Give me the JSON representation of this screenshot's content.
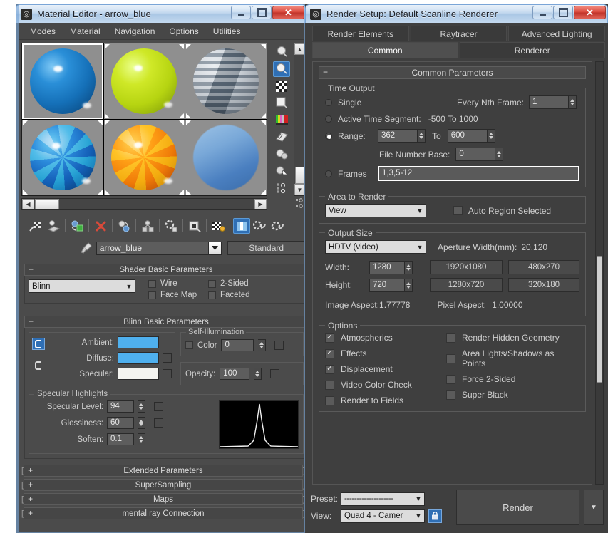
{
  "material_editor": {
    "title": "Material Editor - arrow_blue",
    "icon": "max-logo-icon",
    "window_buttons": {
      "minimize": "minimize-icon",
      "maximize": "maximize-icon",
      "close": "close-icon"
    },
    "menus": [
      "Modes",
      "Material",
      "Navigation",
      "Options",
      "Utilities"
    ],
    "slots": [
      {
        "name": "slot-1",
        "color": "#1878c8",
        "active": true
      },
      {
        "name": "slot-2",
        "color": "#c8e020",
        "active": false
      },
      {
        "name": "slot-3",
        "color": "#b4b4b4",
        "active": false
      },
      {
        "name": "slot-4",
        "color": "#3a9cd8",
        "active": false
      },
      {
        "name": "slot-5",
        "color": "#f0a018",
        "active": false
      },
      {
        "name": "slot-6",
        "color": "#6c9ed0",
        "active": false
      }
    ],
    "material_name": "arrow_blue",
    "material_type_button": "Standard",
    "shader_basic": {
      "header": "Shader Basic Parameters",
      "shader": "Blinn",
      "checks": [
        {
          "label": "Wire",
          "checked": false
        },
        {
          "label": "2-Sided",
          "checked": false
        },
        {
          "label": "Face Map",
          "checked": false
        },
        {
          "label": "Faceted",
          "checked": false
        }
      ]
    },
    "blinn_basic": {
      "header": "Blinn Basic Parameters",
      "ambient_label": "Ambient:",
      "ambient_color": "#4fb0ee",
      "diffuse_label": "Diffuse:",
      "diffuse_color": "#4fb0ee",
      "specular_label": "Specular:",
      "specular_color": "#f4f4f0",
      "self_illum_label": "Self-Illumination",
      "self_illum_color_label": "Color",
      "self_illum_value": "0",
      "self_illum_checked": false,
      "opacity_label": "Opacity:",
      "opacity_value": "100",
      "specular_highlights_label": "Specular Highlights",
      "specular_level_label": "Specular Level:",
      "specular_level_value": "94",
      "glossiness_label": "Glossiness:",
      "glossiness_value": "60",
      "soften_label": "Soften:",
      "soften_value": "0.1"
    },
    "collapsed_rollouts": [
      "Extended Parameters",
      "SuperSampling",
      "Maps",
      "mental ray Connection"
    ],
    "toolbar_icons": [
      "get-material-icon",
      "put-material-to-scene-icon",
      "assign-material-to-selection-icon",
      "reset-map-icon",
      "make-material-copy-icon",
      "make-unique-icon",
      "put-to-library-icon",
      "material-effects-channel-icon",
      "show-shaded-material-in-viewport-icon",
      "show-end-result-icon",
      "go-to-parent-icon",
      "go-forward-to-sibling-icon"
    ],
    "vertical_toolbar_icons": [
      "sample-type-icon",
      "backlight-icon",
      "background-icon",
      "sample-uv-tiling-icon",
      "video-color-check-icon",
      "make-preview-icon",
      "options-icon",
      "material-map-navigator-icon",
      "select-by-material-icon"
    ],
    "scrollbars": {
      "h_left": "◀",
      "h_right": "▶",
      "v_up": "▲",
      "v_down": "▼"
    }
  },
  "render_setup": {
    "title": "Render Setup: Default Scanline Renderer",
    "icon": "max-logo-icon",
    "window_buttons": {
      "minimize": "minimize-icon",
      "maximize": "maximize-icon",
      "close": "close-icon"
    },
    "tabs_row1": [
      {
        "label": "Render Elements",
        "active": false
      },
      {
        "label": "Raytracer",
        "active": false
      },
      {
        "label": "Advanced Lighting",
        "active": false
      }
    ],
    "tabs_row2": [
      {
        "label": "Common",
        "active": true
      },
      {
        "label": "Renderer",
        "active": false
      }
    ],
    "common_parameters_header": "Common Parameters",
    "time_output": {
      "label": "Time Output",
      "single_label": "Single",
      "single_selected": false,
      "every_nth_frame_label": "Every Nth Frame:",
      "every_nth_frame_value": "1",
      "active_time_segment_label": "Active Time Segment:",
      "active_time_segment_value": "-500 To 1000",
      "active_time_segment_selected": false,
      "range_label": "Range:",
      "range_selected": true,
      "range_from": "362",
      "range_to_label": "To",
      "range_to": "600",
      "file_number_base_label": "File Number Base:",
      "file_number_base_value": "0",
      "frames_label": "Frames",
      "frames_selected": false,
      "frames_value": "1,3,5-12"
    },
    "area_to_render": {
      "label": "Area to Render",
      "value": "View",
      "auto_region_label": "Auto Region Selected",
      "auto_region_checked": false
    },
    "output_size": {
      "label": "Output Size",
      "preset": "HDTV (video)",
      "aperture_label": "Aperture Width(mm):",
      "aperture_value": "20.120",
      "width_label": "Width:",
      "width_value": "1280",
      "height_label": "Height:",
      "height_value": "720",
      "preset_buttons": [
        "1920x1080",
        "480x270",
        "1280x720",
        "320x180"
      ],
      "image_aspect_label": "Image Aspect:",
      "image_aspect_value": "1.77778",
      "pixel_aspect_label": "Pixel Aspect:",
      "pixel_aspect_value": "1.00000"
    },
    "options": {
      "label": "Options",
      "left": [
        {
          "label": "Atmospherics",
          "checked": true
        },
        {
          "label": "Effects",
          "checked": true
        },
        {
          "label": "Displacement",
          "checked": true
        },
        {
          "label": "Video Color Check",
          "checked": false
        },
        {
          "label": "Render to Fields",
          "checked": false
        }
      ],
      "right": [
        {
          "label": "Render Hidden Geometry",
          "checked": false
        },
        {
          "label": "Area Lights/Shadows as Points",
          "checked": false
        },
        {
          "label": "Force 2-Sided",
          "checked": false
        },
        {
          "label": "Super Black",
          "checked": false
        }
      ]
    },
    "footer": {
      "preset_label": "Preset:",
      "preset_value": "--------------------",
      "view_label": "View:",
      "view_value": "Quad 4 - Camer",
      "lock_icon": "lock-icon",
      "render_button": "Render",
      "render_dropdown": "chevron-down-icon"
    }
  },
  "theme": {
    "accent_blue": "#2f6fb5",
    "panel_bg": "#3f3f3f",
    "me_panel_bg": "#4b4b4b",
    "text": "#d3d3d3"
  }
}
